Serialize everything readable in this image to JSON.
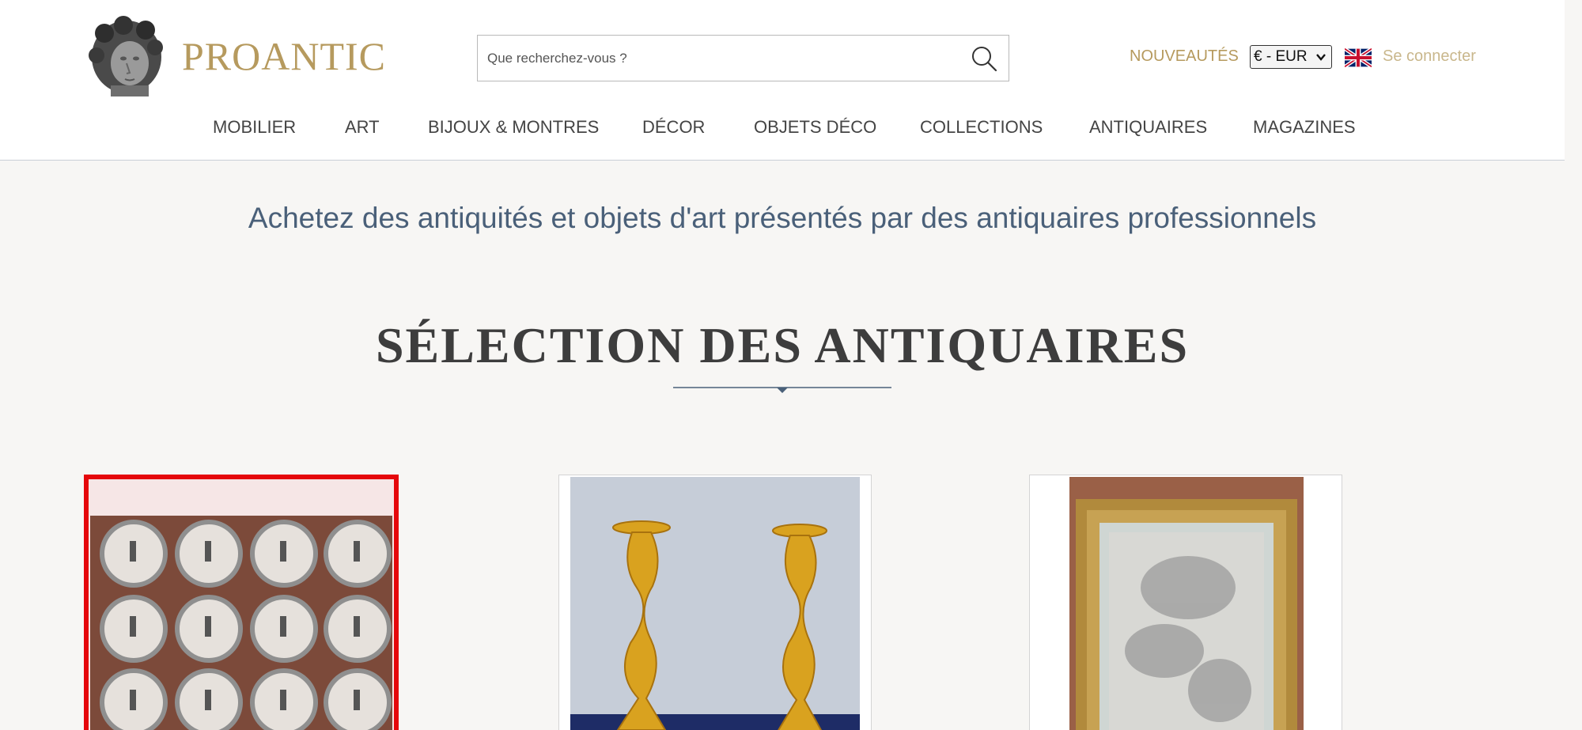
{
  "header": {
    "logo_text": "PROANTIC",
    "search": {
      "placeholder": "Que recherchez-vous ?"
    },
    "nouveautes_label": "NOUVEAUTÉS",
    "currency_value": "€ - EUR",
    "language_flag": "uk-flag-icon",
    "login_label": "Se connecter"
  },
  "nav": {
    "items": [
      {
        "label": "MOBILIER"
      },
      {
        "label": "ART"
      },
      {
        "label": "BIJOUX & MONTRES"
      },
      {
        "label": "DÉCOR"
      },
      {
        "label": "OBJETS DÉCO"
      },
      {
        "label": "COLLECTIONS"
      },
      {
        "label": "ANTIQUAIRES"
      },
      {
        "label": "MAGAZINES"
      }
    ]
  },
  "main": {
    "tagline": "Achetez des antiquités et objets d'art présentés par des antiquaires professionnels",
    "section_title": "SÉLECTION DES ANTIQUAIRES",
    "products": [
      {
        "image": "plates-image"
      },
      {
        "image": "candlesticks-image"
      },
      {
        "image": "framed-drawing-image"
      }
    ]
  },
  "colors": {
    "gold": "#b69a5e",
    "navy_text": "#4a6079",
    "highlight": "#e5070b"
  }
}
